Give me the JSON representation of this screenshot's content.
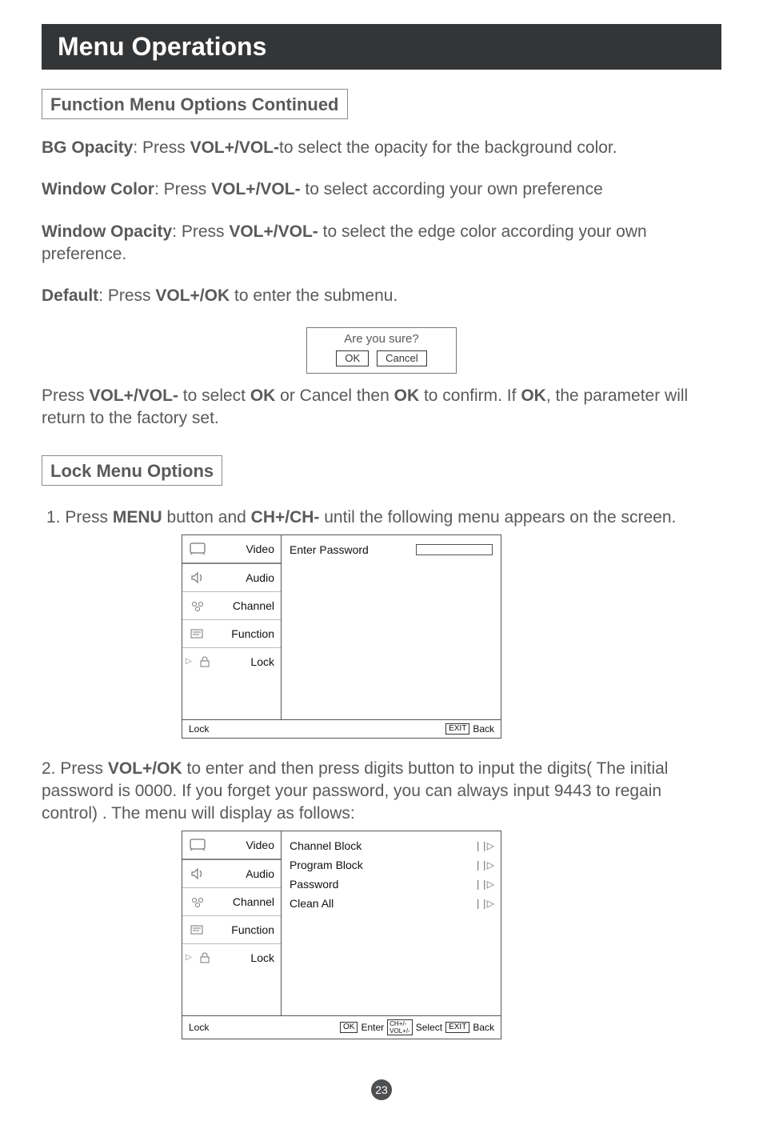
{
  "title": "Menu Operations",
  "section1_title": "Function Menu Options Continued",
  "section2_title": "Lock Menu Options",
  "p_bg": {
    "label": "BG Opacity",
    "verb": ": Press ",
    "key": "VOL+/VOL-",
    "rest": "to select the opacity for the background color."
  },
  "p_wc": {
    "label": "Window Color",
    "verb": ": Press ",
    "key": "VOL+/VOL-",
    "rest": " to select according your own preference"
  },
  "p_wo": {
    "label": "Window Opacity",
    "verb": ": Press ",
    "key": "VOL+/VOL-",
    "rest": " to select the edge color according your own preference."
  },
  "p_default": {
    "label": "Default",
    "verb": ": Press ",
    "key": "VOL+/OK",
    "rest": " to enter the submenu."
  },
  "confirm": {
    "question": "Are you sure?",
    "ok": "OK",
    "cancel": "Cancel"
  },
  "p_confirm": {
    "a": "Press ",
    "k1": "VOL+/VOL-",
    "b": " to select ",
    "k2": "OK",
    "c": " or Cancel then ",
    "k3": "OK",
    "d": " to confirm. If ",
    "k4": "OK",
    "e": ", the parameter will return to the factory set."
  },
  "step1": {
    "a": "1. Press ",
    "k1": "MENU",
    "b": " button and ",
    "k2": "CH+/CH-",
    "c": " until the following menu appears on the screen."
  },
  "step2": {
    "a": "2. Press ",
    "k1": "VOL+/OK",
    "b": " to enter and then press digits button to input the digits( The initial password is 0000. If you forget your password, you can always input 9443 to regain control) . The menu will display as follows:"
  },
  "osd": {
    "tabs": [
      "Video",
      "Audio",
      "Channel",
      "Function",
      "Lock"
    ],
    "footer_title": "Lock",
    "enter_password": "Enter Password",
    "ok_label": "OK",
    "enter_label": "Enter",
    "select_label": "Select",
    "exit_label": "EXIT",
    "back_label": "Back",
    "chvol_top": "CH+/-",
    "chvol_bot": "VOL+/-"
  },
  "lockmenu": {
    "items": [
      "Channel Block",
      "Program Block",
      "Password",
      "Clean All"
    ]
  },
  "page_number": "23"
}
